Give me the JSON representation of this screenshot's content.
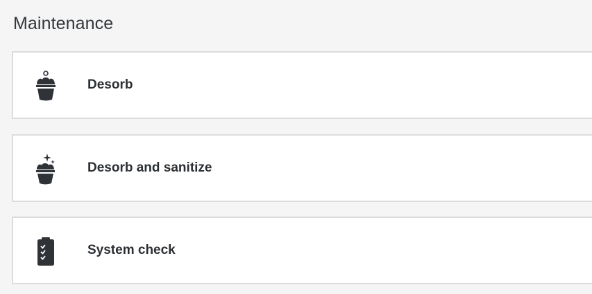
{
  "section": {
    "title": "Maintenance"
  },
  "items": [
    {
      "label": "Desorb",
      "icon": "bucket-icon"
    },
    {
      "label": "Desorb and sanitize",
      "icon": "bucket-sparkle-icon"
    },
    {
      "label": "System check",
      "icon": "clipboard-check-icon"
    }
  ],
  "colors": {
    "background": "#f5f5f5",
    "card": "#ffffff",
    "border": "#dcdcdc",
    "text": "#2b2f33",
    "icon": "#2f3337"
  }
}
